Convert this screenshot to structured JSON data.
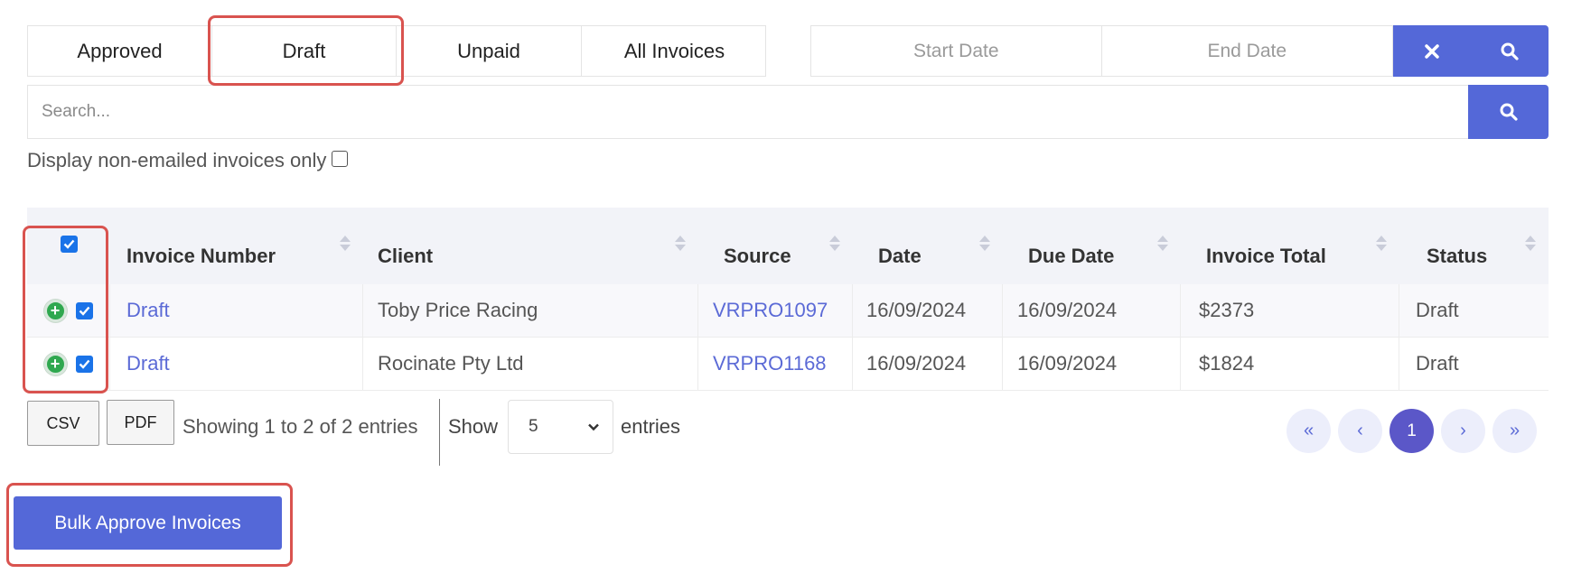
{
  "tabs": [
    {
      "label": "Approved"
    },
    {
      "label": "Draft"
    },
    {
      "label": "Unpaid"
    },
    {
      "label": "All Invoices"
    }
  ],
  "date_filter": {
    "start_placeholder": "Start Date",
    "end_placeholder": "End Date",
    "clear_icon": "times-icon",
    "search_icon": "search-icon"
  },
  "search": {
    "placeholder": "Search...",
    "button_icon": "search-icon"
  },
  "non_emailed_label": "Display non-emailed invoices only",
  "non_emailed_checked": false,
  "table": {
    "columns": [
      "Invoice Number",
      "Client",
      "Source",
      "Date",
      "Due Date",
      "Invoice Total",
      "Status"
    ],
    "select_all_checked": true,
    "rows": [
      {
        "invoice": "Draft",
        "client": "Toby Price Racing",
        "source": "VRPRO1097",
        "date": "16/09/2024",
        "due": "16/09/2024",
        "total": "$2373",
        "status": "Draft",
        "checked": true
      },
      {
        "invoice": "Draft",
        "client": "Rocinate Pty Ltd",
        "source": "VRPRO1168",
        "date": "16/09/2024",
        "due": "16/09/2024",
        "total": "$1824",
        "status": "Draft",
        "checked": true
      }
    ]
  },
  "footer": {
    "csv_label": "CSV",
    "pdf_label": "PDF",
    "showing_text": "Showing 1 to 2 of 2 entries",
    "show_label": "Show",
    "page_size": "5",
    "entries_label": "entries"
  },
  "pagination": {
    "first": "«",
    "prev": "‹",
    "current": "1",
    "next": "›",
    "last": "»"
  },
  "bulk_button_label": "Bulk Approve Invoices",
  "colors": {
    "accent": "#5468d8",
    "link": "#5b6ad6",
    "highlight": "#d9534f",
    "plus_green": "#2fa84f"
  }
}
